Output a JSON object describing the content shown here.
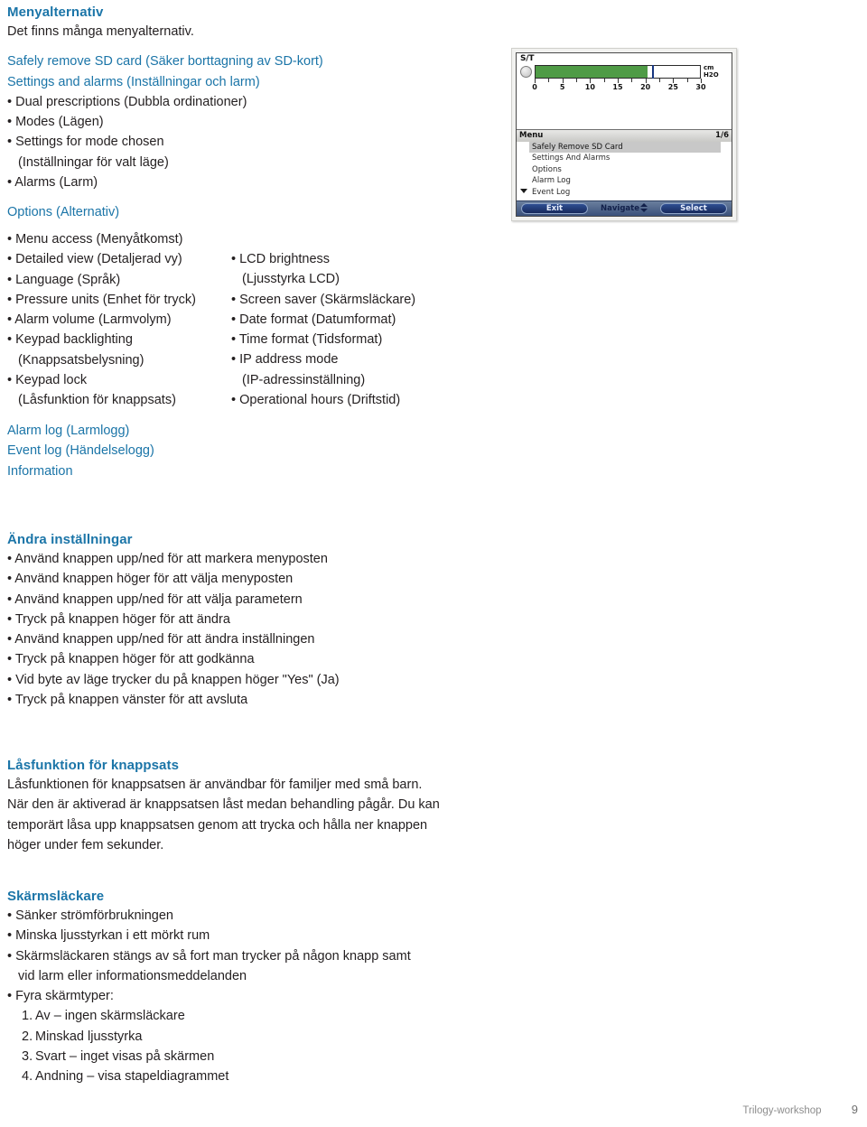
{
  "menu_options": {
    "heading": "Menyalternativ",
    "intro": "Det finns många menyalternativ.",
    "link1": "Safely remove SD card (Säker borttagning av SD-kort)",
    "link2": "Settings and alarms (Inställningar och larm)",
    "bullets": [
      "• Dual prescriptions (Dubbla ordinationer)",
      "• Modes (Lägen)",
      "• Settings for mode chosen",
      "(Inställningar för valt läge)",
      "• Alarms (Larm)"
    ],
    "options_link": "Options (Alternativ)"
  },
  "options_columns": {
    "left": [
      "• Menu access (Menyåtkomst)",
      "• Detailed view (Detaljerad vy)",
      "• Language (Språk)",
      "• Pressure units (Enhet för tryck)",
      "• Alarm volume (Larmvolym)",
      "• Keypad backlighting",
      "(Knappsatsbelysning)",
      "• Keypad lock",
      "(Låsfunktion för knappsats)"
    ],
    "right": [
      "• LCD brightness",
      "(Ljusstyrka LCD)",
      "• Screen saver (Skärmsläckare)",
      "• Date format (Datumformat)",
      "• Time format (Tidsformat)",
      "• IP address mode",
      "(IP-adressinställning)",
      "• Operational hours (Driftstid)"
    ]
  },
  "logs": {
    "alarm_log": "Alarm log (Larmlogg)",
    "event_log": "Event log (Händelselogg)",
    "information": "Information"
  },
  "change_settings": {
    "heading": "Ändra inställningar",
    "bullets": [
      "• Använd knappen upp/ned för att markera menyposten",
      "• Använd knappen höger för att välja menyposten",
      "• Använd knappen upp/ned för att välja parametern",
      "• Tryck på knappen höger för att ändra",
      "• Använd knappen upp/ned för att ändra inställningen",
      "• Tryck på knappen höger för att godkänna",
      "• Vid byte av läge trycker du på knappen höger \"Yes\" (Ja)",
      "• Tryck på knappen vänster för att avsluta"
    ]
  },
  "keypad_lock": {
    "heading": "Låsfunktion för knappsats",
    "paragraph": [
      "Låsfunktionen för knappsatsen är användbar för familjer med små barn.",
      "När den är aktiverad är knappsatsen låst medan behandling pågår. Du kan",
      "temporärt låsa upp knappsatsen genom att trycka och hålla ner knappen",
      "höger under fem sekunder."
    ]
  },
  "screensaver": {
    "heading": "Skärmsläckare",
    "bullets": [
      "• Sänker strömförbrukningen",
      "• Minska ljusstyrkan i ett mörkt rum",
      "• Skärmsläckaren stängs av så fort man trycker på någon knapp samt",
      "vid larm eller informationsmeddelanden",
      "• Fyra skärmtyper:"
    ],
    "numbered": [
      {
        "n": "1.",
        "text": "Av – ingen skärmsläckare"
      },
      {
        "n": "2.",
        "text": "Minskad ljusstyrka"
      },
      {
        "n": "3.",
        "text": "Svart – inget visas på skärmen"
      },
      {
        "n": "4.",
        "text": "Andning – visa stapeldiagrammet"
      }
    ]
  },
  "device_screen": {
    "mode_label": "S/T",
    "pressure_units": "cm\nH2O",
    "bar": {
      "fill_value": 20.5,
      "marker_value": 21.2,
      "axis_min": 0,
      "axis_max": 30,
      "fill_color": "#4f9b46",
      "marker_color": "#17357f"
    },
    "axis_labels": [
      "0",
      "5",
      "10",
      "15",
      "20",
      "25",
      "30"
    ],
    "menu_bar_title": "Menu",
    "menu_bar_page": "1/6",
    "menu_items": [
      "Safely Remove SD Card",
      "Settings And Alarms",
      "Options",
      "Alarm Log",
      "Event Log"
    ],
    "selected_index": 0,
    "softkeys": {
      "left": "Exit",
      "middle": "Navigate",
      "right": "Select"
    }
  },
  "footer": {
    "document_name": "Trilogy-workshop",
    "page_number": "9"
  },
  "colors": {
    "heading_blue": "#1b75a8",
    "body_dark": "#231f20",
    "footer_grey": "#8d8d8d"
  }
}
